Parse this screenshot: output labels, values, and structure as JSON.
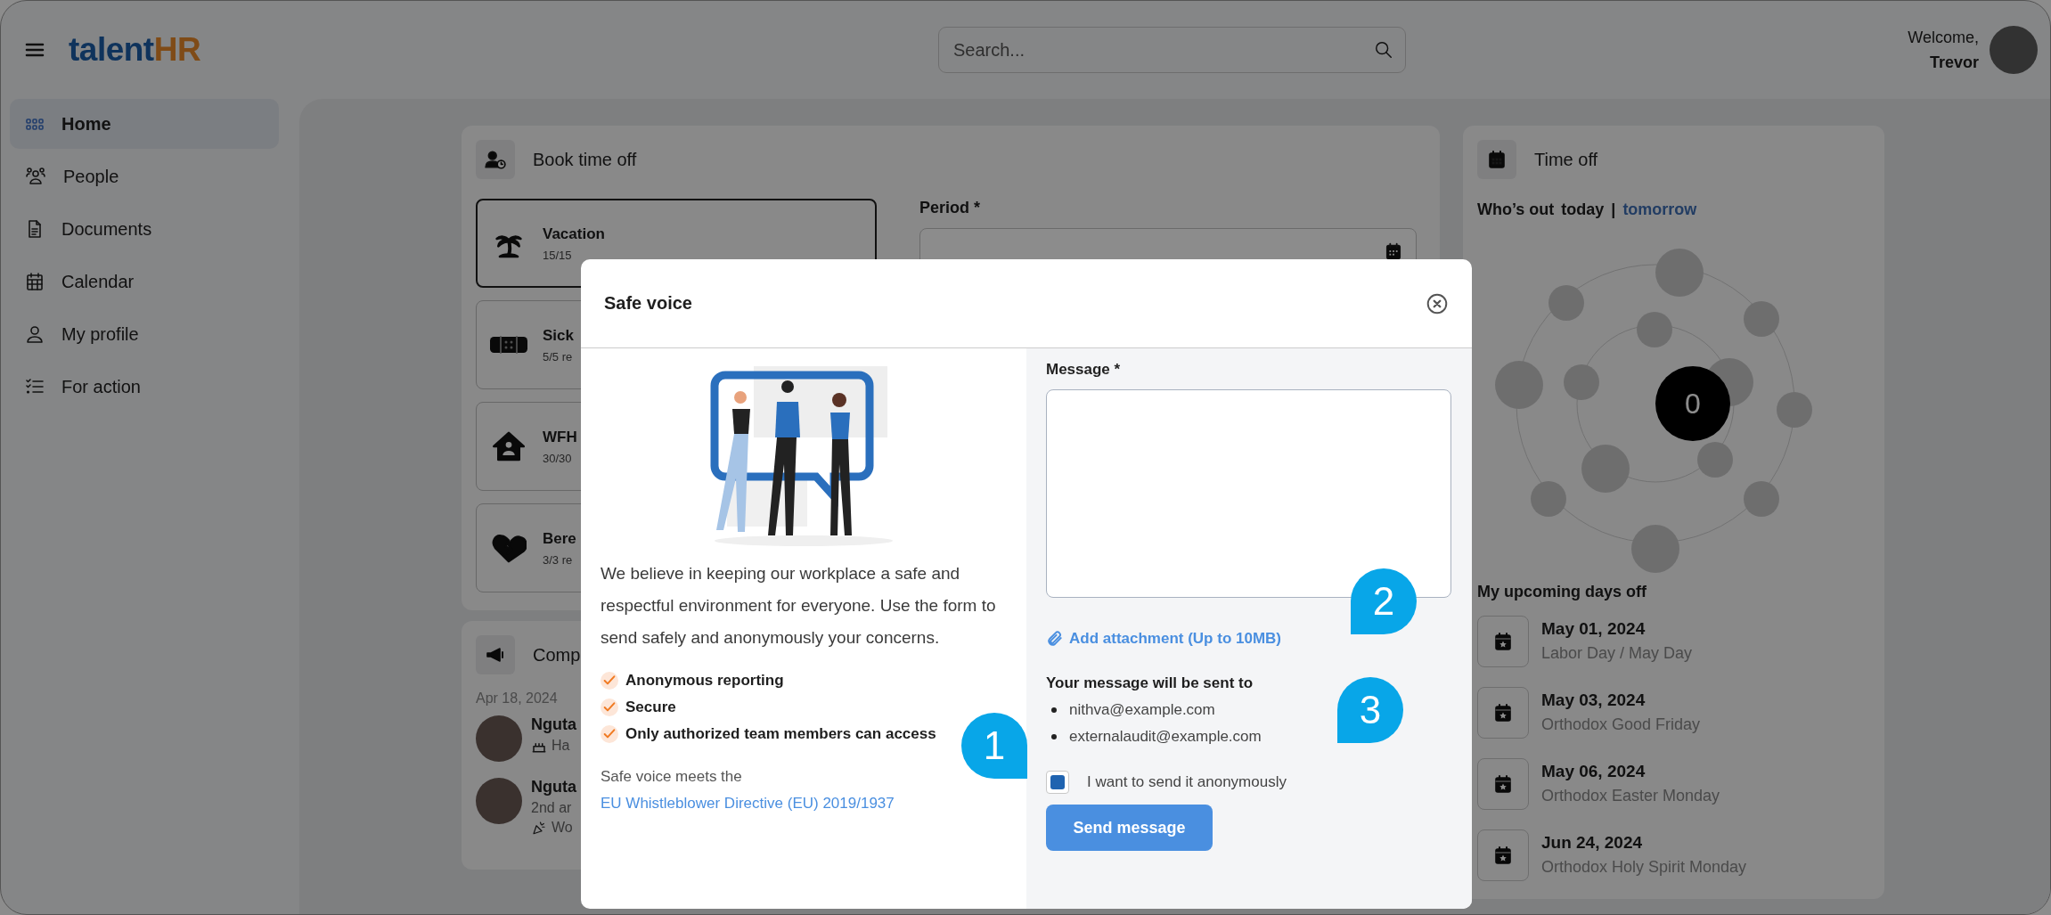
{
  "header": {
    "logo": {
      "primary": "talent",
      "accent": "HR"
    },
    "search": {
      "placeholder": "Search..."
    },
    "user": {
      "greeting": "Welcome,",
      "name": "Trevor"
    }
  },
  "sidebar": {
    "items": [
      {
        "label": "Home",
        "selected": true
      },
      {
        "label": "People",
        "selected": false
      },
      {
        "label": "Documents",
        "selected": false
      },
      {
        "label": "Calendar",
        "selected": false
      },
      {
        "label": "My profile",
        "selected": false
      },
      {
        "label": "For action",
        "selected": false
      }
    ]
  },
  "book_time_off": {
    "title": "Book time off",
    "types": [
      {
        "name": "Vacation",
        "remaining": "15/15",
        "selected": true
      },
      {
        "name": "Sick",
        "remaining": "5/5 re",
        "selected": false
      },
      {
        "name": "WFH",
        "remaining": "30/30",
        "selected": false
      },
      {
        "name": "Bere",
        "remaining": "3/3 re",
        "selected": false
      }
    ],
    "period": {
      "label": "Period *"
    }
  },
  "company": {
    "title": "Comp",
    "date": "Apr 18, 2024",
    "entries": [
      {
        "name": "Nguta",
        "lines": [
          {
            "text": "Ha",
            "kind": "birthday"
          }
        ]
      },
      {
        "name": "Nguta",
        "lines": [
          {
            "text": "2nd ar",
            "kind": "plain"
          },
          {
            "text": "Wo",
            "kind": "anniversary"
          }
        ]
      }
    ]
  },
  "time_off": {
    "title": "Time off",
    "whos_out": {
      "label": "Who’s out",
      "separator": "|",
      "options": [
        {
          "label": "today",
          "selected": true
        },
        {
          "label": "tomorrow",
          "selected": false
        }
      ]
    },
    "count": "0",
    "upcoming_title": "My upcoming days off",
    "upcoming": [
      {
        "date": "May 01, 2024",
        "name": "Labor Day / May Day"
      },
      {
        "date": "May 03, 2024",
        "name": "Orthodox Good Friday"
      },
      {
        "date": "May 06, 2024",
        "name": "Orthodox Easter Monday"
      },
      {
        "date": "Jun 24, 2024",
        "name": "Orthodox Holy Spirit Monday"
      }
    ]
  },
  "modal": {
    "title": "Safe voice",
    "description": "We believe in keeping our workplace a safe and respectful environment for everyone. Use the form to send safely and anonymously your concerns.",
    "features": [
      "Anonymous reporting",
      "Secure",
      "Only authorized team members can access"
    ],
    "compliance": {
      "text": "Safe voice meets the",
      "link": "EU Whistleblower Directive (EU) 2019/1937"
    },
    "message": {
      "label": "Message *"
    },
    "attachment": "Add attachment (Up to 10MB)",
    "recipients": {
      "title": "Your message will be sent to",
      "emails": [
        "nithva@example.com",
        "externalaudit@example.com"
      ]
    },
    "anonymous": {
      "label": "I want to send it anonymously",
      "checked": true
    },
    "submit": "Send message"
  },
  "callouts": [
    {
      "label": "1"
    },
    {
      "label": "2"
    },
    {
      "label": "3"
    }
  ]
}
